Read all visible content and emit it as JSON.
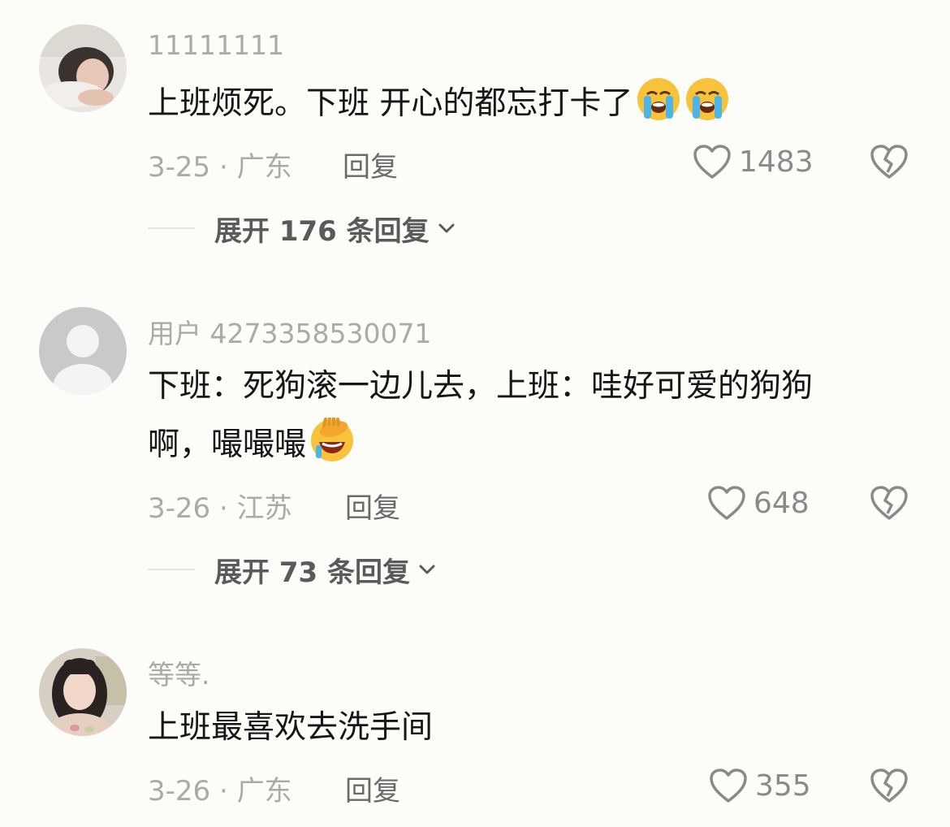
{
  "comments": [
    {
      "username": "11111111",
      "text": "上班烦死。下班 开心的都忘打卡了",
      "emojis": [
        "loudly-crying-face",
        "loudly-crying-face"
      ],
      "date_location": "3-25 · 广东",
      "reply_label": "回复",
      "likes": "1483",
      "expand_label": "展开 176 条回复"
    },
    {
      "username": "用户 4273358530071",
      "text_line1": "下班：死狗滚一边儿去，上班：哇好可爱的狗狗",
      "text_line2": "啊，嘬嘬嘬",
      "emojis": [
        "face-palm-laughing"
      ],
      "date_location": "3-26 · 江苏",
      "reply_label": "回复",
      "likes": "648",
      "expand_label": "展开 73 条回复"
    },
    {
      "username": "等等.",
      "text": "上班最喜欢去洗手间",
      "date_location": "3-26 · 广东",
      "reply_label": "回复",
      "likes": "355"
    }
  ],
  "colors": {
    "background": "#fcfcf8",
    "username": "#aaaaa8",
    "content": "#161616",
    "meta": "#aaaaa8",
    "action": "#6a6a6a"
  }
}
